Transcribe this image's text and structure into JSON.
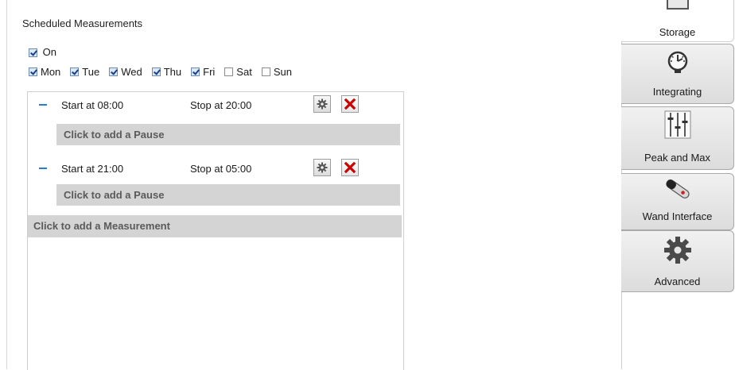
{
  "scheduled": {
    "title": "Scheduled Measurements",
    "on": {
      "label": "On",
      "checked": true
    },
    "days": [
      {
        "label": "Mon",
        "checked": true
      },
      {
        "label": "Tue",
        "checked": true
      },
      {
        "label": "Wed",
        "checked": true
      },
      {
        "label": "Thu",
        "checked": true
      },
      {
        "label": "Fri",
        "checked": true
      },
      {
        "label": "Sat",
        "checked": false
      },
      {
        "label": "Sun",
        "checked": false
      }
    ],
    "measurements": [
      {
        "start": "Start at 08:00",
        "stop": "Stop at 20:00",
        "pause_label": "Click to add a Pause"
      },
      {
        "start": "Start at 21:00",
        "stop": "Stop at 05:00",
        "pause_label": "Click to add a Pause"
      }
    ],
    "add_measurement_label": "Click to add a Measurement"
  },
  "tabs": [
    {
      "label": "Storage",
      "icon": "storage-icon",
      "active": true
    },
    {
      "label": "Integrating",
      "icon": "gauge-icon",
      "active": false
    },
    {
      "label": "Peak and Max",
      "icon": "sliders-icon",
      "active": false
    },
    {
      "label": "Wand Interface",
      "icon": "wand-icon",
      "active": false
    },
    {
      "label": "Advanced",
      "icon": "gear-icon",
      "active": false
    }
  ],
  "colors": {
    "accent": "#2a7fd0",
    "delete": "#cc0000",
    "bar": "#d4d4d4"
  }
}
